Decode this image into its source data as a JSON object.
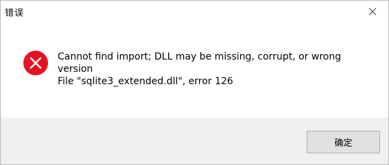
{
  "window": {
    "title": "错误",
    "close_icon": "close-icon"
  },
  "message": {
    "line1": "Cannot find import; DLL may be missing, corrupt, or wrong",
    "line2": "version",
    "line3": "File \"sqlite3_extended.dll\", error 126",
    "icon": "error-icon",
    "icon_color": "#e81123"
  },
  "buttons": {
    "ok_label": "确定"
  }
}
